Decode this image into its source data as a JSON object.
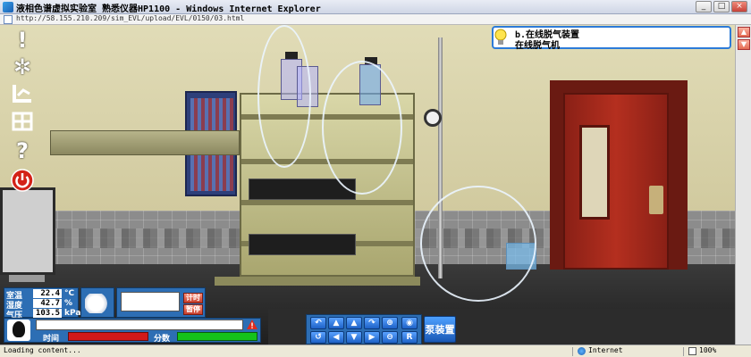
{
  "window": {
    "title": "液相色谱虚拟实验室 熟悉仪器HP1100 - Windows Internet Explorer",
    "address": "http://58.155.210.209/sim_EVL/upload/EVL/0150/03.html"
  },
  "info_bubble": {
    "title": "b.在线脱气装置",
    "subtitle": "在线脱气机"
  },
  "left_toolbar": {
    "icons": [
      "exclamation-icon",
      "gear-icon",
      "chart-icon",
      "grid-icon",
      "question-icon",
      "power-icon"
    ]
  },
  "environment": {
    "temperature_label": "室温",
    "temperature_value": "22.4",
    "temperature_unit": "°C",
    "humidity_label": "湿度",
    "humidity_value": "42.7",
    "humidity_unit": "%",
    "pressure_label": "气压",
    "pressure_value": "103.5",
    "pressure_unit": "kPa"
  },
  "timer": {
    "start_label": "计时",
    "stop_label": "暂停"
  },
  "status_panel": {
    "time_label": "时间",
    "score_label": "分数"
  },
  "navigation": {
    "buttons": [
      "↶",
      "▲",
      "↷",
      "⊕",
      "◉",
      "↺",
      "◀",
      "▼",
      "▶",
      "⊖",
      "R"
    ],
    "device_label": "泵装置"
  },
  "statusbar": {
    "text": "Loading content...",
    "zone": "Internet",
    "zoom": "100%"
  },
  "colors": {
    "hud_blue": "#2d6eb4",
    "time_bar": "#d1191b",
    "score_bar": "#15c21a",
    "bubble_border": "#2d7bd8"
  }
}
